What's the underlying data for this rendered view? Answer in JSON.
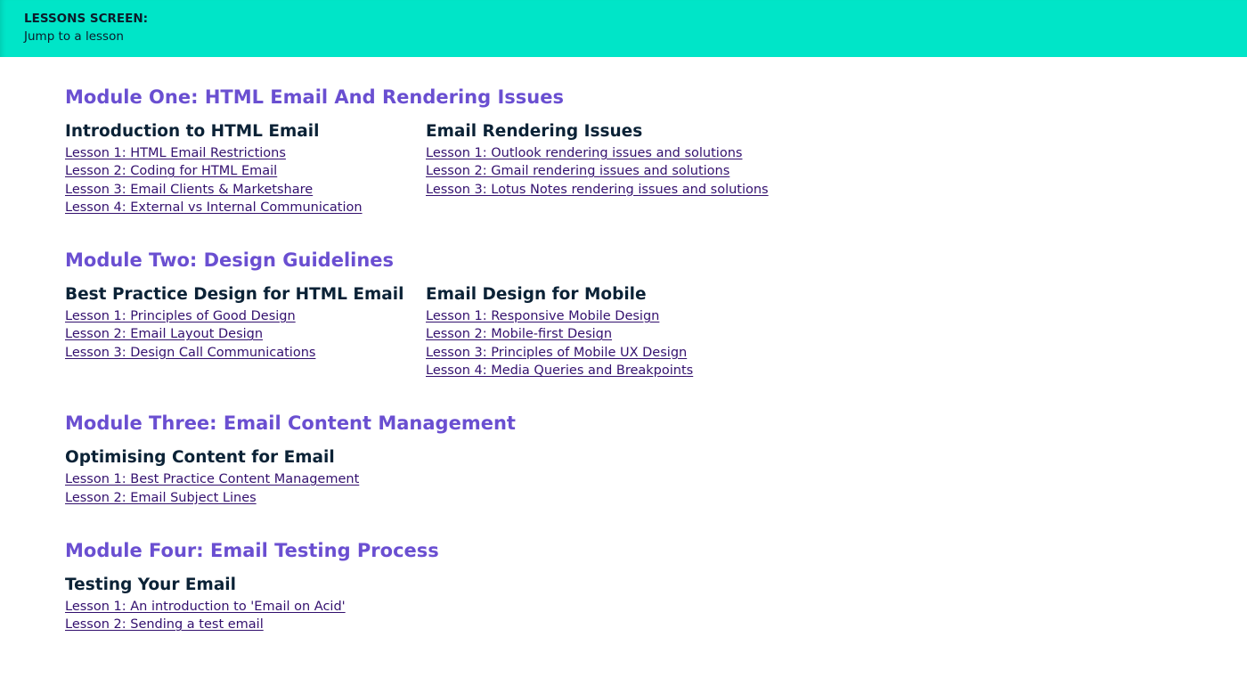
{
  "header": {
    "title": "LESSONS SCREEN:",
    "subtitle": "Jump to a lesson"
  },
  "modules": [
    {
      "title": "Module One: HTML Email And Rendering Issues",
      "sections": [
        {
          "title": "Introduction to HTML Email",
          "lessons": [
            "Lesson 1: HTML Email Restrictions",
            "Lesson 2: Coding for HTML Email",
            "Lesson 3: Email Clients & Marketshare",
            "Lesson 4: External vs Internal Communication"
          ]
        },
        {
          "title": "Email Rendering Issues",
          "lessons": [
            "Lesson 1: Outlook rendering issues and solutions",
            "Lesson 2: Gmail rendering issues and solutions",
            "Lesson 3: Lotus Notes rendering issues and solutions"
          ]
        }
      ]
    },
    {
      "title": "Module Two: Design Guidelines",
      "sections": [
        {
          "title": "Best Practice Design for HTML Email",
          "lessons": [
            "Lesson 1: Principles of Good Design",
            "Lesson 2: Email Layout Design",
            "Lesson 3: Design Call Communications"
          ]
        },
        {
          "title": "Email Design for Mobile",
          "lessons": [
            "Lesson 1: Responsive Mobile Design",
            "Lesson 2: Mobile-first Design",
            "Lesson 3: Principles of Mobile UX Design",
            "Lesson 4: Media Queries and Breakpoints"
          ]
        }
      ]
    },
    {
      "title": "Module Three: Email Content Management",
      "sections": [
        {
          "title": "Optimising Content for Email",
          "lessons": [
            "Lesson 1: Best Practice Content Management",
            "Lesson 2: Email Subject Lines"
          ]
        }
      ]
    },
    {
      "title": "Module Four: Email Testing Process",
      "sections": [
        {
          "title": "Testing Your Email",
          "lessons": [
            "Lesson 1: An introduction to 'Email on Acid'",
            "Lesson 2: Sending a test email"
          ]
        }
      ]
    }
  ],
  "colors": {
    "header_bg": "#00e5c8",
    "module_title": "#6a4fd1",
    "section_title": "#0b2236",
    "link": "#33106e"
  }
}
